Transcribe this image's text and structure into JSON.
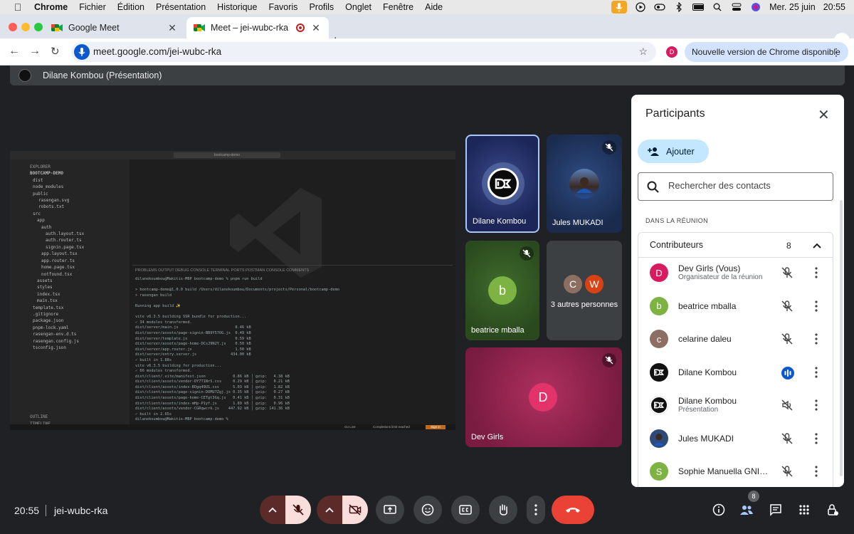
{
  "menubar": {
    "app": "Chrome",
    "items": [
      "Fichier",
      "Édition",
      "Présentation",
      "Historique",
      "Favoris",
      "Profils",
      "Onglet",
      "Fenêtre",
      "Aide"
    ],
    "datetime_date": "Mer. 25 juin",
    "datetime_time": "20:55"
  },
  "tabs": [
    {
      "label": "Google Meet",
      "active": false
    },
    {
      "label": "Meet – jei-wubc-rka",
      "active": true
    }
  ],
  "toolbar": {
    "url": "meet.google.com/jei-wubc-rka",
    "profile_initial": "D",
    "update_label": "Nouvelle version de Chrome disponible"
  },
  "presenter_bar": {
    "label": "Dilane Kombou (Présentation)"
  },
  "screenshare": {
    "search": "bootcamp-demo",
    "explorer_header": "EXPLORER",
    "project": "BOOTCAMP-DEMO",
    "tree": [
      "dist",
      "node_modules",
      "public",
      "rasengan.svg",
      "robots.txt",
      "src",
      "app",
      "auth",
      "auth.layout.tsx",
      "auth.router.ts",
      "signin.page.tsx",
      "app.layout.tsx",
      "app.router.ts",
      "home.page.tsx",
      "notfound.tsx",
      "assets",
      "styles",
      "index.tsx",
      "main.tsx",
      "template.tsx",
      ".gitignore",
      "package.json",
      "pnpm-lock.yaml",
      "rasengan-env.d.ts",
      "rasengan.config.js",
      "tsconfig.json"
    ],
    "outline": "OUTLINE",
    "timeline": "TIMELINE",
    "panel_tabs": "PROBLEMS   OUTPUT   DEBUG CONSOLE   TERMINAL   PORTS   POSTMAN CONSOLE   COMMENTS",
    "terminal": "dilanekoumbou@Makitis-MBP bootcamp-demo % pnpm run build\n\n> bootcamp-demo@1.0.0 build /Users/dilanekoumbou/Documents/projects/Personal/bootcamp-demo\n> rasengan build\n\nRunning app build ✨\n\nvite v6.3.5 building SSR bundle for production...\n✓ 34 modules transformed.\ndist/server/main.js                         8.46 kB\ndist/server/assets/page-signin-BB9Y57OG.js  0.49 kB\ndist/server/template.js                     0.59 kB\ndist/server/assets/page-home-DCsJ9N2Y.js    0.50 kB\ndist/server/app.router.js                   1.50 kB\ndist/server/entry.server.js               434.00 kB\n✓ built in 1.88s\nvite v6.3.5 building for production...\n✓ 66 modules transformed.\ndist/client/.vite/manifest.json            0.86 kB │ gzip:   4.38 kB\ndist/client/assets/vendor-DY7T1NrS.css     0.29 kB │ gzip:   0.21 kB\ndist/client/assets/index-BOgq49U1.css      5.03 kB │ gzip:   1.82 kB\ndist/client/assets/page-signin-DOMU7Zgj.js 0.35 kB │ gzip:   0.27 kB\ndist/client/assets/page-home-CETgt3Gq.js   0.41 kB │ gzip:   0.31 kB\ndist/client/assets/index-mHp-P1yf.js       1.89 kB │ gzip:   0.96 kB\ndist/client/assets/vendor-CGRqwcrk.js    447.92 kB │ gzip: 141.36 kB\n✓ built in 2.65s\ndilanekoumbou@Makitis-MBP bootcamp-demo % ",
    "status_golive": "Go Live",
    "status_completions": "Completions limit reached",
    "status_signin": "Sign in"
  },
  "tiles": [
    {
      "name": "Dilane Kombou",
      "muted": false
    },
    {
      "name": "Jules MUKADI",
      "muted": true
    },
    {
      "name": "beatrice mballa",
      "initial": "b",
      "muted": true
    },
    {
      "name": "3 autres personnes",
      "initials": [
        "C",
        "W"
      ]
    },
    {
      "name": "Dev Girls",
      "initial": "D",
      "muted": true
    }
  ],
  "panel": {
    "title": "Participants",
    "add_label": "Ajouter",
    "search_placeholder": "Rechercher des contacts",
    "section_label": "DANS LA RÉUNION",
    "group_label": "Contributeurs",
    "group_count": "8",
    "participants": [
      {
        "name": "Dev Girls (Vous)",
        "sub": "Organisateur de la réunion",
        "initial": "D",
        "color": "#d81b60",
        "mic": "muted"
      },
      {
        "name": "beatrice mballa",
        "sub": "",
        "initial": "b",
        "color": "#7cb342",
        "mic": "muted"
      },
      {
        "name": "celarine daleu",
        "sub": "",
        "initial": "c",
        "color": "#8d6e63",
        "mic": "muted"
      },
      {
        "name": "Dilane Kombou",
        "sub": "",
        "initial": "",
        "color": "#111111",
        "mic": "speaking"
      },
      {
        "name": "Dilane Kombou",
        "sub": "Présentation",
        "initial": "",
        "color": "#111111",
        "mic": "presenting"
      },
      {
        "name": "Jules MUKADI",
        "sub": "",
        "initial": "",
        "color": "#2d4a7a",
        "mic": "muted"
      },
      {
        "name": "Sophie Manuella GNITE...",
        "sub": "",
        "initial": "S",
        "color": "#7cb342",
        "mic": "muted"
      }
    ]
  },
  "bottom": {
    "time": "20:55",
    "meeting_code": "jei-wubc-rka",
    "people_badge": "8"
  },
  "colors": {
    "accent": "#0b57d0",
    "end_call": "#ea4335",
    "mic_off_bg": "#f9dedc"
  }
}
